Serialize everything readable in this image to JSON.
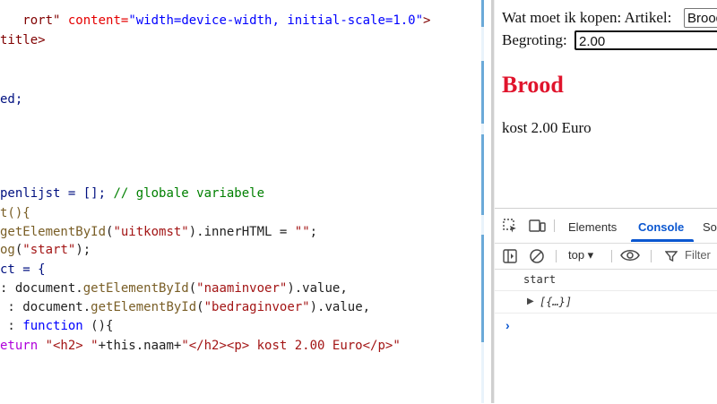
{
  "editor": {
    "lines": [
      [
        {
          "t": "   ",
          "c": "plain"
        },
        {
          "t": "rort\"",
          "c": "tag"
        },
        {
          "t": " content=",
          "c": "attr"
        },
        {
          "t": "\"width=device-width, initial-scale=1.0\"",
          "c": "str"
        },
        {
          "t": ">",
          "c": "tag"
        }
      ],
      [
        {
          "t": "title>",
          "c": "tag"
        }
      ],
      [
        {
          "t": "",
          "c": "plain"
        }
      ],
      [
        {
          "t": "",
          "c": "plain"
        }
      ],
      [
        {
          "t": "ed;",
          "c": "var"
        }
      ],
      [
        {
          "t": "",
          "c": "plain"
        }
      ],
      [
        {
          "t": "",
          "c": "plain"
        }
      ],
      [
        {
          "t": "",
          "c": "plain"
        }
      ],
      [
        {
          "t": "",
          "c": "plain"
        }
      ],
      [
        {
          "t": "penlijst = []; ",
          "c": "var"
        },
        {
          "t": "// globale variabele",
          "c": "comment"
        }
      ],
      [
        {
          "t": "t(){",
          "c": "fn"
        }
      ],
      [
        {
          "t": "getElementById",
          "c": "fn"
        },
        {
          "t": "(",
          "c": "plain"
        },
        {
          "t": "\"uitkomst\"",
          "c": "red"
        },
        {
          "t": ").innerHTML = ",
          "c": "plain"
        },
        {
          "t": "\"\"",
          "c": "red"
        },
        {
          "t": ";",
          "c": "plain"
        }
      ],
      [
        {
          "t": "og",
          "c": "fn"
        },
        {
          "t": "(",
          "c": "plain"
        },
        {
          "t": "\"start\"",
          "c": "red"
        },
        {
          "t": ");",
          "c": "plain"
        }
      ],
      [
        {
          "t": "ct = {",
          "c": "var"
        }
      ],
      [
        {
          "t": ": document.",
          "c": "plain"
        },
        {
          "t": "getElementById",
          "c": "fn"
        },
        {
          "t": "(",
          "c": "plain"
        },
        {
          "t": "\"naaminvoer\"",
          "c": "red"
        },
        {
          "t": ").value,",
          "c": "plain"
        }
      ],
      [
        {
          "t": " : document.",
          "c": "plain"
        },
        {
          "t": "getElementById",
          "c": "fn"
        },
        {
          "t": "(",
          "c": "plain"
        },
        {
          "t": "\"bedraginvoer\"",
          "c": "red"
        },
        {
          "t": ").value,",
          "c": "plain"
        }
      ],
      [
        {
          "t": " : ",
          "c": "plain"
        },
        {
          "t": "function",
          "c": "kw2"
        },
        {
          "t": " (){",
          "c": "plain"
        }
      ],
      [
        {
          "t": "eturn ",
          "c": "kw"
        },
        {
          "t": "\"<h2> \"",
          "c": "red"
        },
        {
          "t": "+this.naam+",
          "c": "plain"
        },
        {
          "t": "\"</h2><p> kost 2.00 Euro</p>\"",
          "c": "red"
        }
      ]
    ]
  },
  "preview": {
    "article_label": "Wat moet ik kopen: Artikel:",
    "article_value": "Brood",
    "budget_label": "Begroting:",
    "budget_value": "2.00",
    "result_title": "Brood",
    "result_text": "kost 2.00 Euro",
    "title_color": "#e0142c"
  },
  "devtools": {
    "tabs": [
      "Elements",
      "Console",
      "So"
    ],
    "active_tab": "Console",
    "context": "top ▾",
    "filter_label": "Filter",
    "messages": [
      "start",
      "[{…}]"
    ],
    "icons": [
      "inspect-icon",
      "device-toggle-icon",
      "sidebar-icon",
      "clear-console-icon",
      "eye-icon",
      "filter-icon",
      "expand-triangle-icon",
      "prompt-chevron-icon"
    ],
    "accent_color": "#0b57d0"
  }
}
